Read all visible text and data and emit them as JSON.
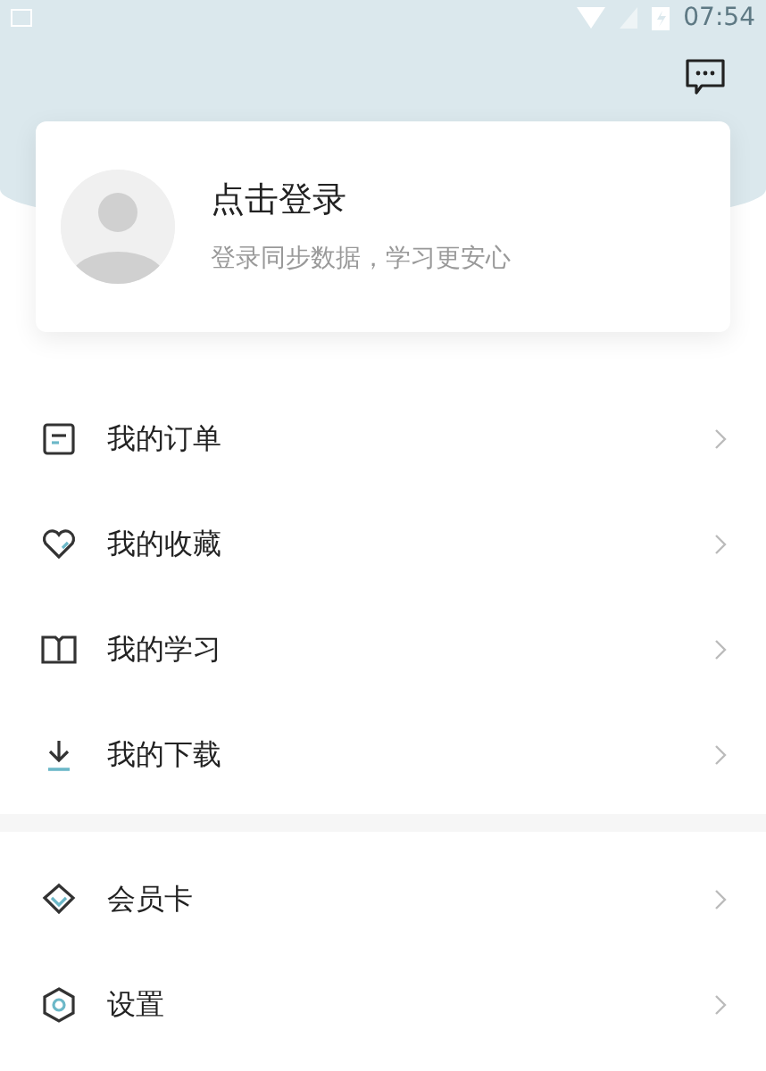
{
  "status_bar": {
    "time": "07:54"
  },
  "profile": {
    "title": "点击登录",
    "subtitle": "登录同步数据，学习更安心"
  },
  "menu_groups": [
    {
      "items": [
        {
          "label": "我的订单",
          "kind": "order"
        },
        {
          "label": "我的收藏",
          "kind": "favorite"
        },
        {
          "label": "我的学习",
          "kind": "study"
        },
        {
          "label": "我的下载",
          "kind": "download"
        }
      ]
    },
    {
      "items": [
        {
          "label": "会员卡",
          "kind": "member"
        },
        {
          "label": "设置",
          "kind": "settings"
        }
      ]
    }
  ]
}
